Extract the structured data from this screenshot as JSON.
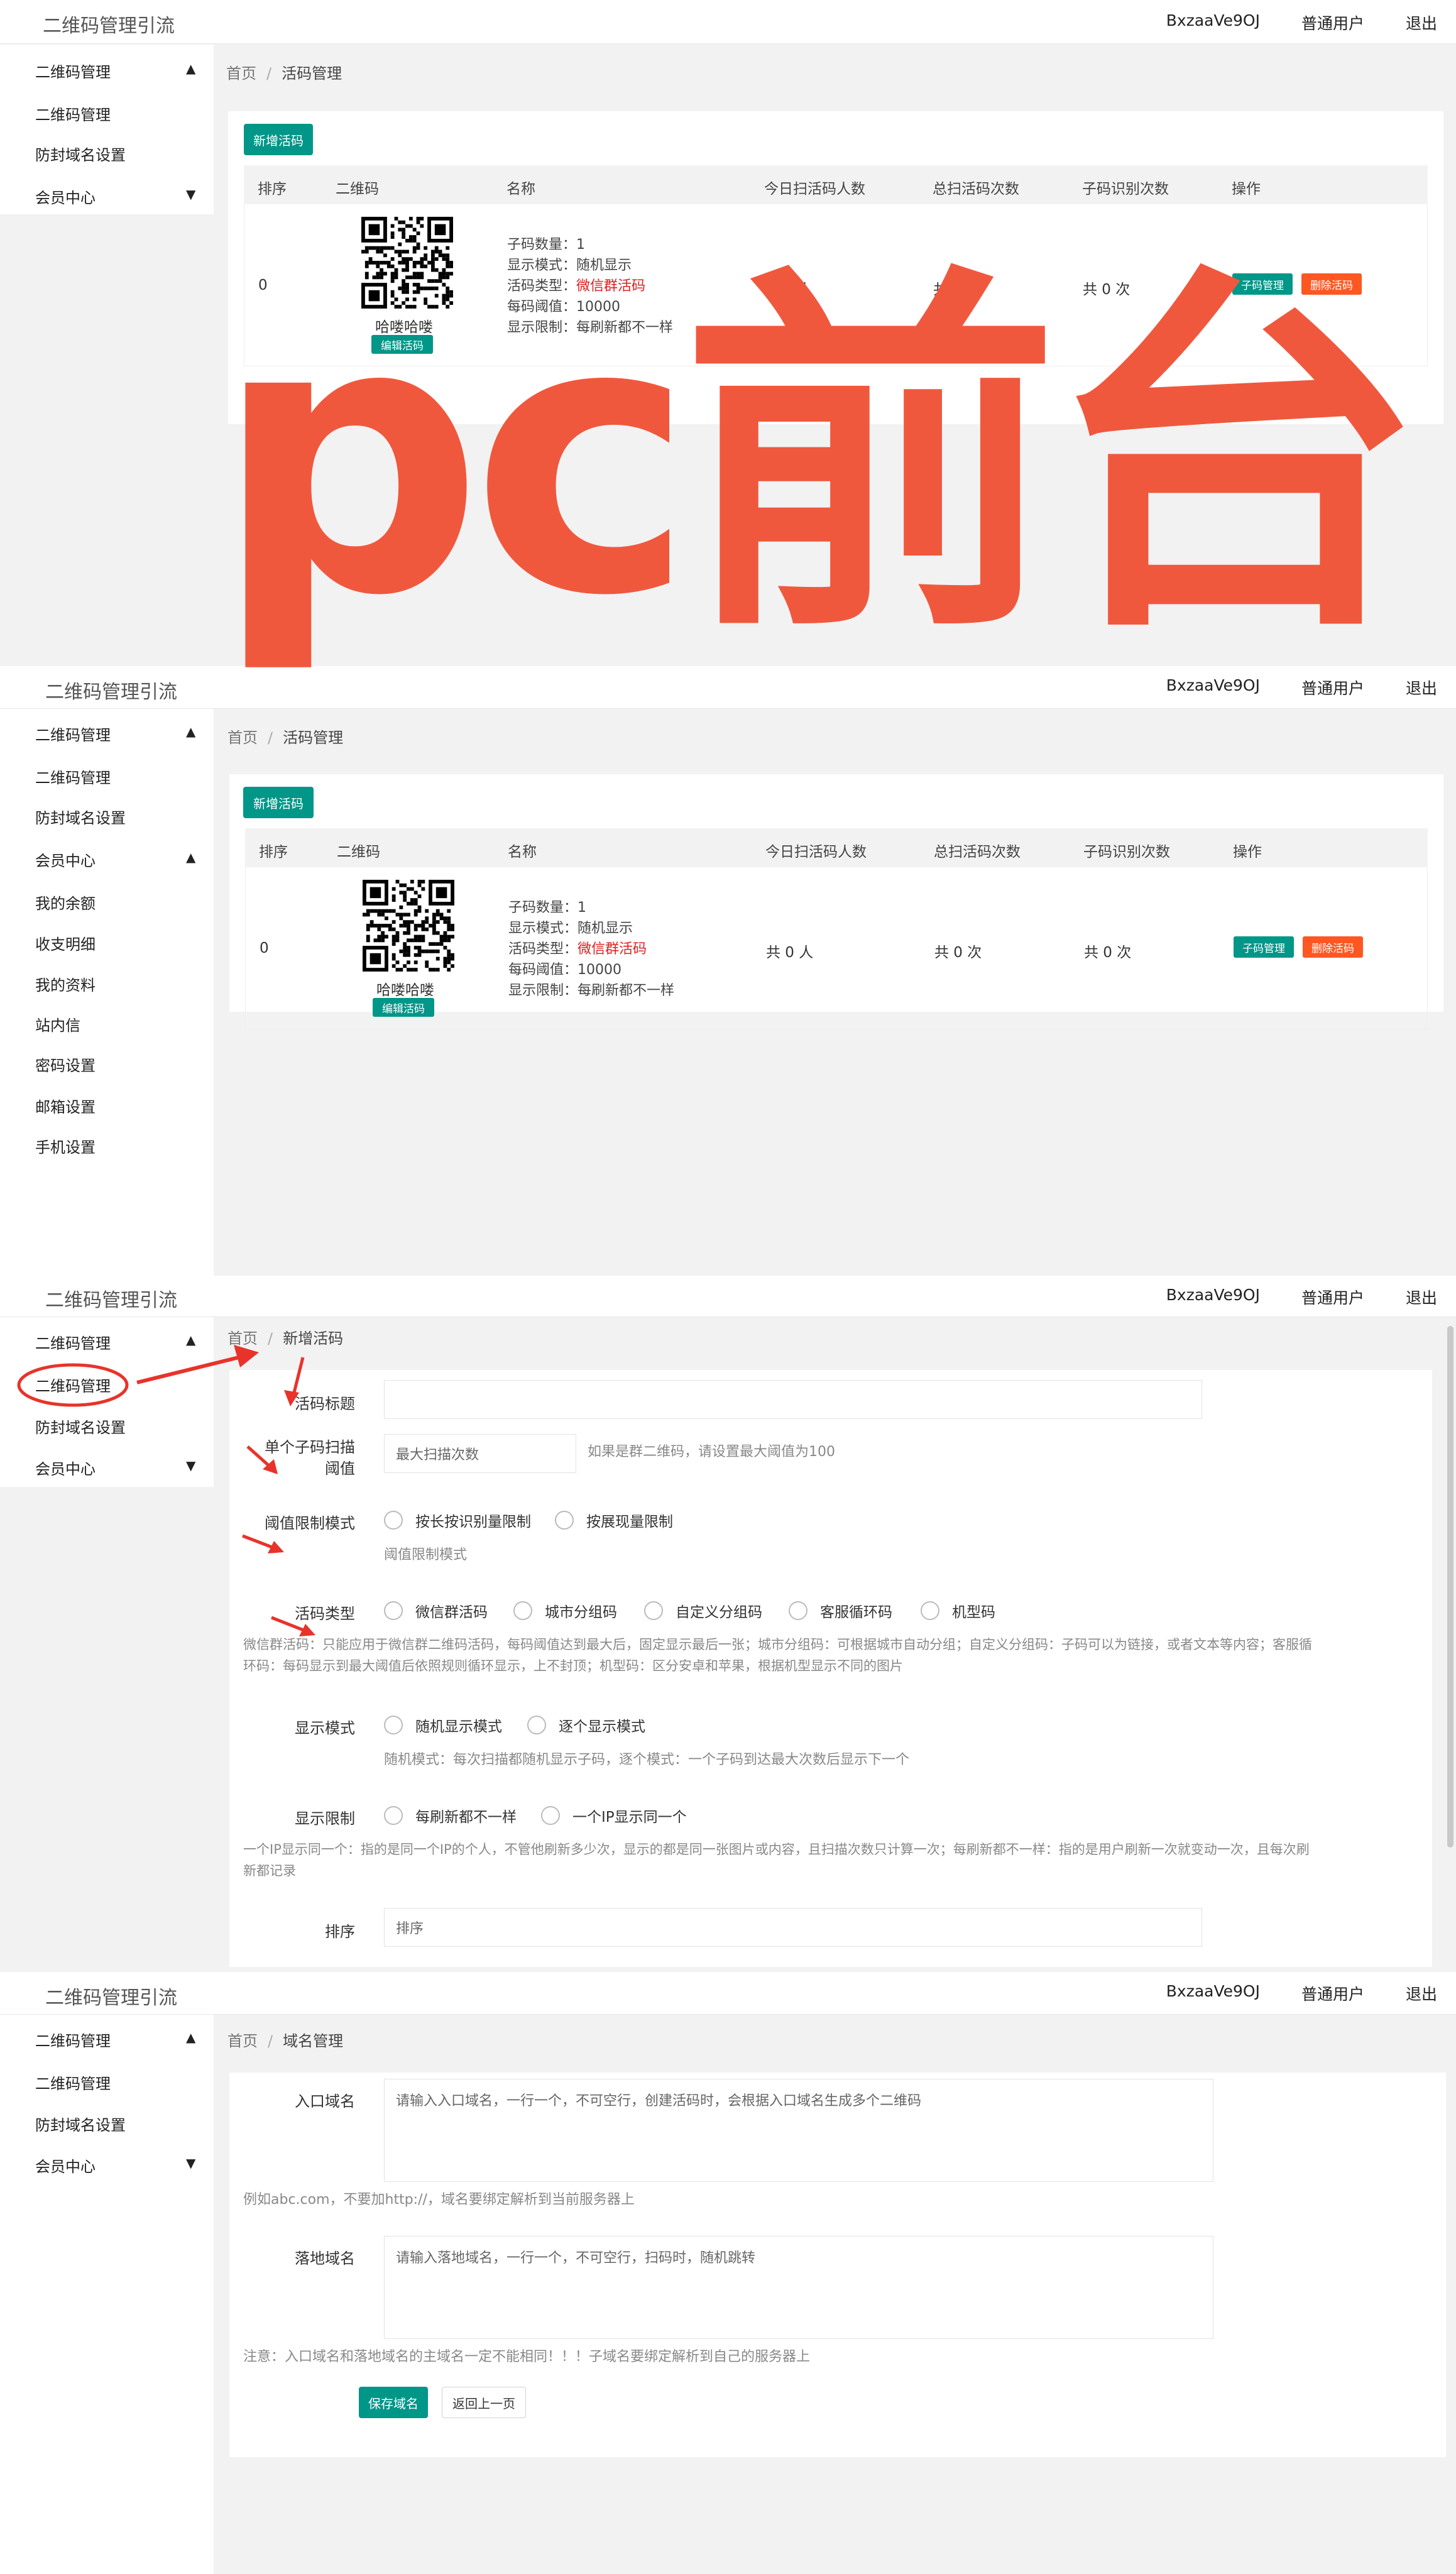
{
  "app": {
    "logo": "二维码管理引流",
    "user": "BxzaaVe9OJ",
    "role": "普通用户",
    "logout": "退出"
  },
  "sidebar": {
    "qr_group": "二维码管理",
    "qr_manage": "二维码管理",
    "domain_setting": "防封域名设置",
    "member_center": "会员中心",
    "member_items": [
      "我的余额",
      "收支明细",
      "我的资料",
      "站内信",
      "密码设置",
      "邮箱设置",
      "手机设置"
    ]
  },
  "breadcrumb": {
    "home": "首页",
    "sep": "/",
    "live_code": "活码管理",
    "new_live_code": "新增活码",
    "domain": "域名管理"
  },
  "list": {
    "add_button": "新增活码",
    "columns": [
      "排序",
      "二维码",
      "名称",
      "今日扫活码人数",
      "总扫活码次数",
      "子码识别次数",
      "操作"
    ],
    "row": {
      "order": "0",
      "qr_name": "哈喽哈喽",
      "edit_button": "编辑活码",
      "desc": {
        "sub_count": "子码数量：1",
        "display_mode": "显示模式：随机显示",
        "type_label": "活码类型：",
        "type_value": "微信群活码",
        "threshold": "每码阈值：10000",
        "limit": "显示限制：每刷新都不一样"
      },
      "today_scans": "共 0 人",
      "total_scans": "共 0 次",
      "sub_scans": "共 0 次",
      "sub_button": "子码管理",
      "delete_button": "删除活码"
    }
  },
  "overlay_text": "pc前台",
  "form_new": {
    "title_label": "活码标题",
    "scan_label_1": "单个子码扫描",
    "scan_label_2": "阈值",
    "scan_placeholder": "最大扫描次数",
    "scan_help": "如果是群二维码，请设置最大阈值为100",
    "threshold_label": "阈值限制模式",
    "threshold_options": [
      "按长按识别量限制",
      "按展现量限制"
    ],
    "threshold_help": "阈值限制模式",
    "type_label": "活码类型",
    "type_options": [
      "微信群活码",
      "城市分组码",
      "自定义分组码",
      "客服循环码",
      "机型码"
    ],
    "type_help_1": "微信群活码：只能应用于微信群二维码活码，每码阈值达到最大后，固定显示最后一张；城市分组码：可根据城市自动分组；自定义分组码：子码可以为链接，或者文本等内容；客服循",
    "type_help_2": "环码：每码显示到最大阈值后依照规则循环显示，上不封顶；机型码：区分安卓和苹果，根据机型显示不同的图片",
    "display_label": "显示模式",
    "display_options": [
      "随机显示模式",
      "逐个显示模式"
    ],
    "display_help": "随机模式：每次扫描都随机显示子码，逐个模式：一个子码到达最大次数后显示下一个",
    "limit_label": "显示限制",
    "limit_options": [
      "每刷新都不一样",
      "一个IP显示同一个"
    ],
    "limit_help_1": "一个IP显示同一个：指的是同一个IP的个人，不管他刷新多少次，显示的都是同一张图片或内容，且扫描次数只计算一次；每刷新都不一样：指的是用户刷新一次就变动一次，且每次刷",
    "limit_help_2": "新都记录",
    "order_label": "排序",
    "order_placeholder": "排序"
  },
  "form_domain": {
    "entry_label": "入口域名",
    "entry_placeholder": "请输入入口域名，一行一个，不可空行，创建活码时，会根据入口域名生成多个二维码",
    "entry_help": "例如abc.com，不要加http://，域名要绑定解析到当前服务器上",
    "landing_label": "落地域名",
    "landing_placeholder": "请输入落地域名，一行一个，不可空行，扫码时，随机跳转",
    "landing_help": "注意：入口域名和落地域名的主域名一定不能相同！！！子域名要绑定解析到自己的服务器上",
    "save_button": "保存域名",
    "back_button": "返回上一页"
  },
  "colors": {
    "primary": "#009688",
    "danger": "#ff5722",
    "overlay": "#f0583d",
    "highlight": "#e02020"
  }
}
